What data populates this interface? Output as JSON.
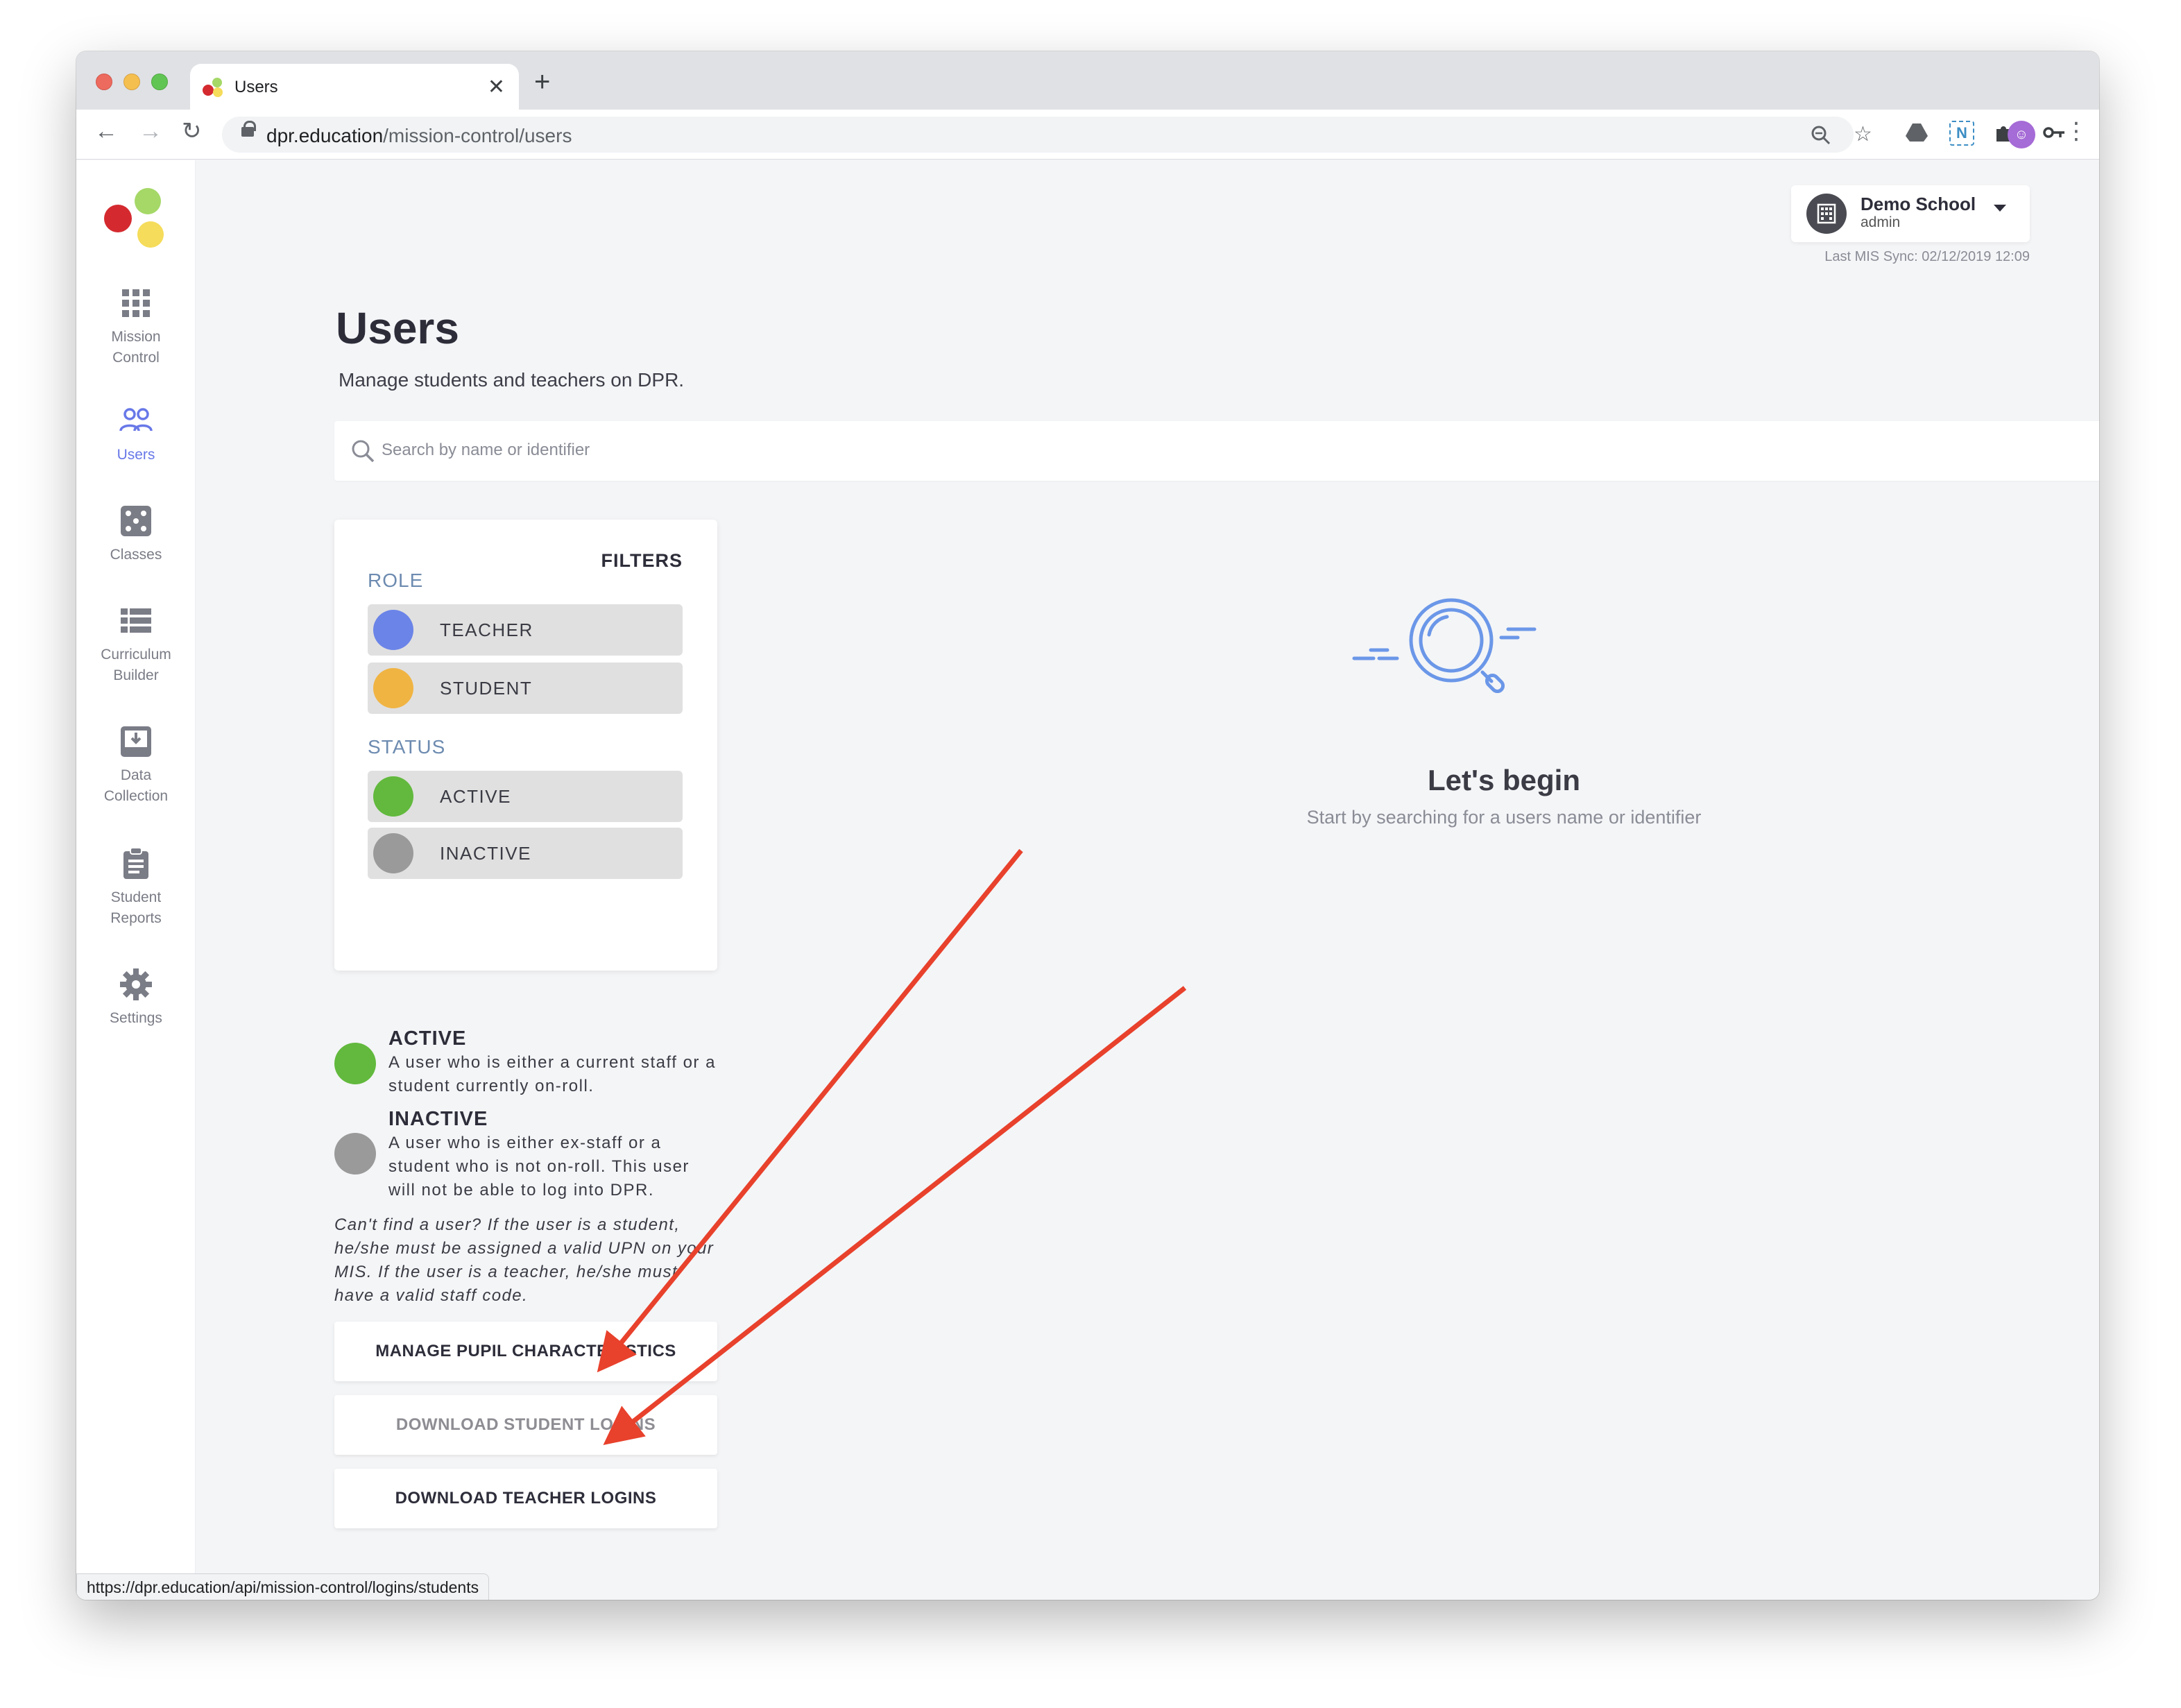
{
  "browser": {
    "tab_title": "Users",
    "url_domain": "dpr.education",
    "url_path": "/mission-control/users",
    "status_url": "https://dpr.education/api/mission-control/logins/students"
  },
  "sidebar": {
    "items": [
      {
        "label_line1": "Mission",
        "label_line2": "Control",
        "icon": "grid-icon"
      },
      {
        "label_line1": "Users",
        "label_line2": "",
        "icon": "users-icon",
        "active": true
      },
      {
        "label_line1": "Classes",
        "label_line2": "",
        "icon": "dice-icon"
      },
      {
        "label_line1": "Curriculum",
        "label_line2": "Builder",
        "icon": "list-icon"
      },
      {
        "label_line1": "Data",
        "label_line2": "Collection",
        "icon": "inbox-icon"
      },
      {
        "label_line1": "Student",
        "label_line2": "Reports",
        "icon": "clipboard-icon"
      },
      {
        "label_line1": "Settings",
        "label_line2": "",
        "icon": "gear-icon"
      }
    ]
  },
  "school": {
    "name": "Demo School",
    "role": "admin",
    "last_sync": "Last MIS Sync: 02/12/2019 12:09"
  },
  "page": {
    "title": "Users",
    "subtitle": "Manage students and teachers on DPR."
  },
  "search": {
    "placeholder": "Search by name or identifier",
    "value": ""
  },
  "filters": {
    "title": "FILTERS",
    "role_label": "ROLE",
    "status_label": "STATUS",
    "role_options": [
      {
        "label": "TEACHER",
        "color": "#6b84e8"
      },
      {
        "label": "STUDENT",
        "color": "#f0b443"
      }
    ],
    "status_options": [
      {
        "label": "ACTIVE",
        "color": "#62b93d"
      },
      {
        "label": "INACTIVE",
        "color": "#9a9a9a"
      }
    ]
  },
  "empty_state": {
    "title": "Let's begin",
    "subtitle": "Start by searching for a users name or identifier"
  },
  "legend": {
    "active_title": "ACTIVE",
    "active_desc": "A user who is either a current staff or a student currently on-roll.",
    "inactive_title": "INACTIVE",
    "inactive_desc": "A user who is either ex-staff or a student who is not on-roll. This user will not be able to log into DPR.",
    "help_note": "Can't find a user? If the user is a student, he/she must be assigned a valid UPN on your MIS. If the user is a teacher, he/she must have a valid staff code."
  },
  "actions": {
    "manage_characteristics": "MANAGE PUPIL CHARACTERISTICS",
    "download_student_logins": "DOWNLOAD STUDENT LOGINS",
    "download_teacher_logins": "DOWNLOAD TEACHER LOGINS"
  },
  "colors": {
    "accent": "#6878e8",
    "annotation_arrow": "#e8412c",
    "logo_red": "#d42a2f",
    "logo_green": "#a5d867",
    "logo_yellow": "#f5dc5a"
  }
}
